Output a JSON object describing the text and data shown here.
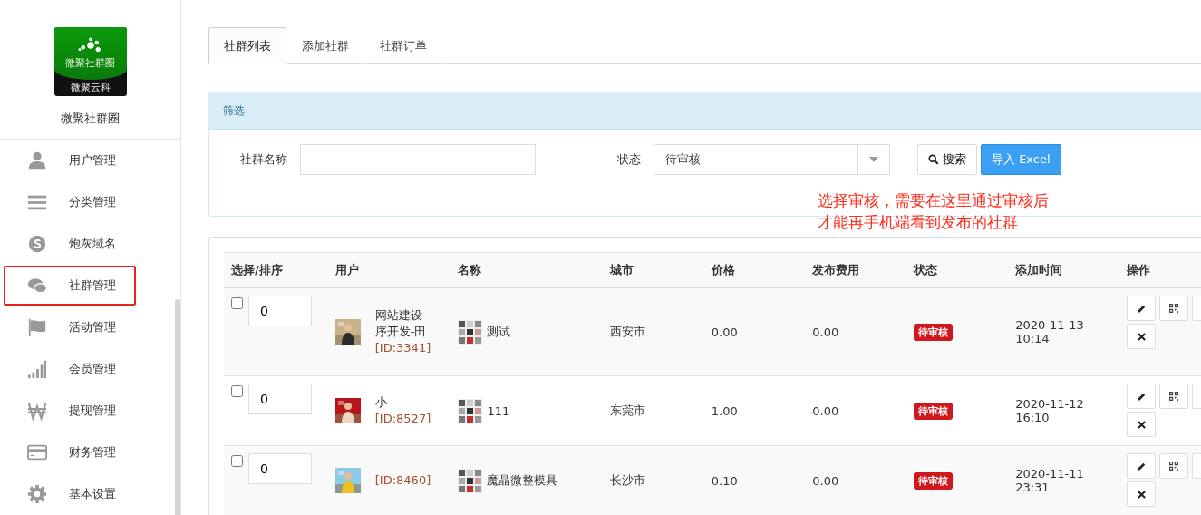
{
  "sidebar": {
    "logo_title": "微聚社群圈",
    "logo_subtitle": "微聚云科",
    "app_name": "微聚社群圈",
    "items": [
      {
        "label": "用户管理",
        "selected": false
      },
      {
        "label": "分类管理",
        "selected": false
      },
      {
        "label": "炮灰域名",
        "selected": false
      },
      {
        "label": "社群管理",
        "selected": true
      },
      {
        "label": "活动管理",
        "selected": false
      },
      {
        "label": "会员管理",
        "selected": false
      },
      {
        "label": "提现管理",
        "selected": false
      },
      {
        "label": "财务管理",
        "selected": false
      },
      {
        "label": "基本设置",
        "selected": false
      }
    ]
  },
  "tabs": [
    {
      "label": "社群列表",
      "selected": true
    },
    {
      "label": "添加社群",
      "selected": false
    },
    {
      "label": "社群订单",
      "selected": false
    }
  ],
  "filter": {
    "title": "筛选",
    "name_label": "社群名称",
    "status_label": "状态",
    "status_value": "待审核",
    "search_button": "搜索",
    "export_button": "导入 Excel"
  },
  "annotation": [
    "选择审核，需要在这里通过审核后",
    "才能再手机端看到发布的社群"
  ],
  "table": {
    "columns": [
      "选择/排序",
      "用户",
      "名称",
      "城市",
      "价格",
      "发布费用",
      "状态",
      "添加时间",
      "操作"
    ],
    "rows": [
      {
        "checked": false,
        "sort": "0",
        "user_lines": [
          "网站建设",
          "序开发-田"
        ],
        "user_id": "[ID:3341]",
        "name": "测试",
        "city": "西安市",
        "price": "0.00",
        "fee": "0.00",
        "status": "待审核",
        "date": "2020-11-13",
        "time": "10:14"
      },
      {
        "checked": false,
        "sort": "0",
        "user_lines": [
          "小"
        ],
        "user_id": "[ID:8527]",
        "name": "111",
        "city": "东莞市",
        "price": "1.00",
        "fee": "0.00",
        "status": "待审核",
        "date": "2020-11-12",
        "time": "16:10"
      },
      {
        "checked": false,
        "sort": "0",
        "user_lines": [],
        "user_id": "[ID:8460]",
        "name": "魔晶微整模具",
        "city": "长沙市",
        "price": "0.10",
        "fee": "0.00",
        "status": "待审核",
        "date": "2020-11-11",
        "time": "23:31"
      }
    ]
  }
}
